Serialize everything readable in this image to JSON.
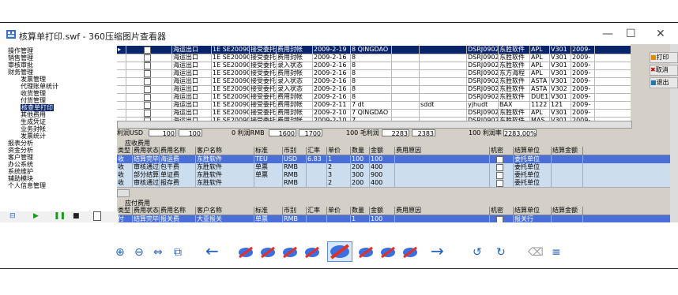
{
  "window": {
    "title": "核算单打印.swf - 360压缩图片查看器",
    "minimize": "—",
    "maximize": "☐",
    "close": "✕"
  },
  "nav": {
    "items": [
      "操作管理",
      "销售管理",
      "审核审批",
      "财务管理",
      "发票管理",
      "代理账单统计",
      "收货管理",
      "付货管理",
      "核查单打印",
      "其他费用",
      "生成凭证",
      "业务封帐",
      "发票统计",
      "报表分析",
      "资金分析",
      "客户管理",
      "办公系统",
      "系统维护",
      "辅助模块",
      "个人信息管理"
    ],
    "selected": "核查单打印"
  },
  "top_grid": {
    "rows": [
      {
        "c1": "海运出口",
        "c2": "1E SE200902",
        "c3": "接受委托",
        "c4": "费用封帐",
        "c5": "2009-2-19",
        "c6": "8 QINGDAO",
        "c7": "",
        "c8": "",
        "c9": "DSRJ0902",
        "c10": "东胜软件",
        "c11": "APL",
        "c12": "V301",
        "c13": "2009-"
      },
      {
        "c1": "海运出口",
        "c2": "1E SE200902",
        "c3": "接受委托",
        "c4": "费用封帐",
        "c5": "2009-2-16",
        "c6": "8",
        "c7": "",
        "c8": "",
        "c9": "DSRJ0902",
        "c10": "东胜软件",
        "c11": "APL",
        "c12": "V301",
        "c13": "2009-"
      },
      {
        "c1": "海运出口",
        "c2": "1E SE200902",
        "c3": "接受委托",
        "c4": "录入状态",
        "c5": "2009-2-16",
        "c6": "8",
        "c7": "",
        "c8": "",
        "c9": "DSRJ0902",
        "c10": "东胜软件",
        "c11": "APL",
        "c12": "V301",
        "c13": "2009-"
      },
      {
        "c1": "海运出口",
        "c2": "1E SE200902",
        "c3": "接受委托",
        "c4": "费用封帐",
        "c5": "2009-2-16",
        "c6": "8",
        "c7": "",
        "c8": "",
        "c9": "DSRJ0902",
        "c10": "东方海程",
        "c11": "APL",
        "c12": "V301",
        "c13": "2009-"
      },
      {
        "c1": "海运出口",
        "c2": "1E SE200902",
        "c3": "接受委托",
        "c4": "录入状态",
        "c5": "2009-2-16",
        "c6": "8",
        "c7": "",
        "c8": "",
        "c9": "DSRJ0902",
        "c10": "东胜软件",
        "c11": "ASTA",
        "c12": "V301",
        "c13": "2009-"
      },
      {
        "c1": "海运出口",
        "c2": "1E SE200902",
        "c3": "接受委托",
        "c4": "录入状态",
        "c5": "2009-2-16",
        "c6": "8",
        "c7": "",
        "c8": "",
        "c9": "DSRJ0902",
        "c10": "东胜软件",
        "c11": "ASTA",
        "c12": "V302",
        "c13": "2009-"
      },
      {
        "c1": "海运出口",
        "c2": "1E SE200902",
        "c3": "接受委托",
        "c4": "费用封帐",
        "c5": "2009-2-16",
        "c6": "8",
        "c7": "",
        "c8": "",
        "c9": "DSRJ0902",
        "c10": "东胜软件",
        "c11": "DUE1",
        "c12": "V301",
        "c13": "2009-"
      },
      {
        "c1": "海运出口",
        "c2": "1E SE200902",
        "c3": "接受委托",
        "c4": "费用封帐",
        "c5": "2009-2-11",
        "c6": "7 dt",
        "c7": "",
        "c8": "sddt",
        "c9": "yjhudt",
        "c10": "BAX",
        "c11": "1122",
        "c12": "121",
        "c13": "2009-"
      },
      {
        "c1": "海运出口",
        "c2": "1E SE200902",
        "c3": "接受委托",
        "c4": "费用封帐",
        "c5": "2009-2-10",
        "c6": "7 QINGDAO",
        "c7": "",
        "c8": "",
        "c9": "DSRJ0902",
        "c10": "东胜软件",
        "c11": "APL",
        "c12": "V301",
        "c13": "2009-"
      },
      {
        "c1": "海运出口",
        "c2": "1E SE200902",
        "c3": "接受委托",
        "c4": "费用封帐",
        "c5": "2009-2-10",
        "c6": "7",
        "c7": "",
        "c8": "",
        "c9": "DSRJ0902",
        "c10": "东胜软件",
        "c11": "MAS",
        "c12": "V301",
        "c13": "2009-"
      },
      {
        "c1": "海运出口",
        "c2": "1E SE200902",
        "c3": "接受委托",
        "c4": "费用封帐",
        "c5": "2009-2-9",
        "c6": "7 d",
        "c7": "",
        "c8": "sddt",
        "c9": "yjhudt",
        "c10": "BAX",
        "c11": "1122",
        "c12": "121",
        "c13": "2009-"
      }
    ]
  },
  "summary": {
    "usd_label": "利润USD",
    "usd_val1": "100",
    "usd_val2": "100",
    "rmb_label": "0 利润RMB",
    "rmb_val1": "1600",
    "rmb_val2": "1700",
    "gross_label": "100 毛利润",
    "gross_val1": "2283",
    "gross_val2": "2383",
    "rate_label": "100 利润率",
    "rate_val": "2283.00%"
  },
  "receivable": {
    "label": "应收费用",
    "headers": [
      "类型",
      "费用状态",
      "费用名称",
      "客户名称",
      "标准",
      "币别",
      "汇率",
      "单价",
      "数量",
      "金额",
      "费用原因",
      "机密",
      "结算单位",
      "结算金额"
    ],
    "rows": [
      [
        "收",
        "结算完毕",
        "海运费",
        "东胜软件",
        "TEU",
        "USD",
        "6.83",
        "1",
        "100",
        "100",
        "",
        "",
        "委托单位",
        ""
      ],
      [
        "收",
        "审核通过",
        "包干费",
        "东胜软件",
        "单票",
        "RMB",
        "",
        "2",
        "200",
        "400",
        "",
        "",
        "委托单位",
        ""
      ],
      [
        "收",
        "部分结算",
        "单证费",
        "东胜软件",
        "单票",
        "RMB",
        "",
        "3",
        "300",
        "900",
        "",
        "",
        "委托单位",
        ""
      ],
      [
        "收",
        "审核通过",
        "报存费",
        "东胜软件",
        "",
        "RMB",
        "",
        "2",
        "200",
        "400",
        "",
        "",
        "委托单位",
        ""
      ]
    ]
  },
  "payable": {
    "label": "应付费用",
    "headers": [
      "类型",
      "费用状态",
      "费用名称",
      "客户名称",
      "标准",
      "币别",
      "汇率",
      "单价",
      "数量",
      "金额",
      "费用原因",
      "机密",
      "结算单位",
      "结算金额"
    ],
    "rows": [
      [
        "付",
        "结算完毕",
        "报关费",
        "大亚报关",
        "单票",
        "RMB",
        "",
        "",
        "1",
        "100",
        "",
        "",
        "报关行",
        ""
      ]
    ]
  },
  "right_buttons": [
    "打印",
    "取消",
    "退出"
  ],
  "toolbar": {
    "zoom_in": "⊕",
    "zoom_out": "⊖",
    "fit": "⇔",
    "screen": "⧉",
    "prev": "←",
    "next": "→",
    "rotate_left": "↺",
    "rotate_right": "↻",
    "delete": "⌫",
    "menu": "≡"
  }
}
